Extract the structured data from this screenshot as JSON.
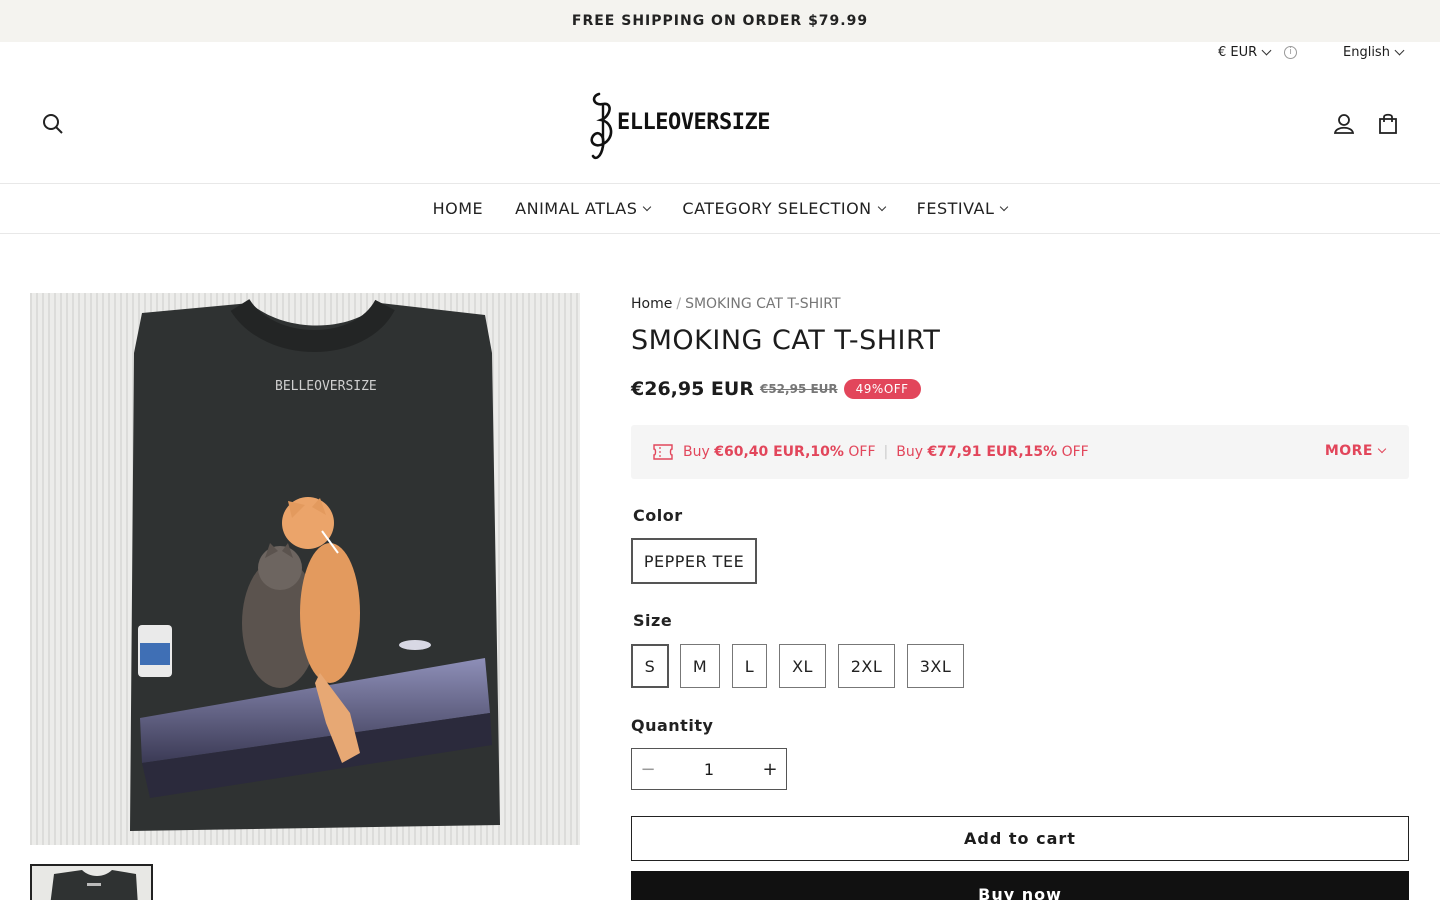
{
  "announcement": "FREE SHIPPING ON ORDER $79.99",
  "locale": {
    "currency": "€ EUR",
    "language": "English"
  },
  "brand": {
    "logo_text": "BELLEOVERSIZE"
  },
  "nav": [
    "HOME",
    "ANIMAL ATLAS",
    "CATEGORY SELECTION",
    "FESTIVAL"
  ],
  "breadcrumb": {
    "home": "Home",
    "separator": "/",
    "current": "SMOKING CAT T-SHIRT"
  },
  "product": {
    "title": "SMOKING CAT T-SHIRT",
    "price": "€26,95 EUR",
    "compare_price": "€52,95 EUR",
    "discount_badge": "49%OFF",
    "shirt_logo_text": "BELLEOVERSIZE"
  },
  "promo": {
    "tier1_prefix": "Buy ",
    "tier1_amount": "€60,40 EUR",
    "tier1_pct": ",10%",
    "tier1_suffix": " OFF",
    "tier2_prefix": "Buy ",
    "tier2_amount": "€77,91 EUR",
    "tier2_pct": ",15%",
    "tier2_suffix": " OFF",
    "divider": "|",
    "more": "MORE"
  },
  "color": {
    "label": "Color",
    "options": [
      "PEPPER TEE"
    ],
    "selected": "PEPPER TEE"
  },
  "size": {
    "label": "Size",
    "options": [
      "S",
      "M",
      "L",
      "XL",
      "2XL",
      "3XL"
    ],
    "selected": "S"
  },
  "quantity": {
    "label": "Quantity",
    "value": "1",
    "minus": "−",
    "plus": "+"
  },
  "buttons": {
    "add_to_cart": "Add to cart",
    "buy_now": "Buy now"
  },
  "colors": {
    "accent": "#e2465b",
    "announce_bg": "#f4f3ef",
    "promo_bg": "#f5f5f5"
  }
}
